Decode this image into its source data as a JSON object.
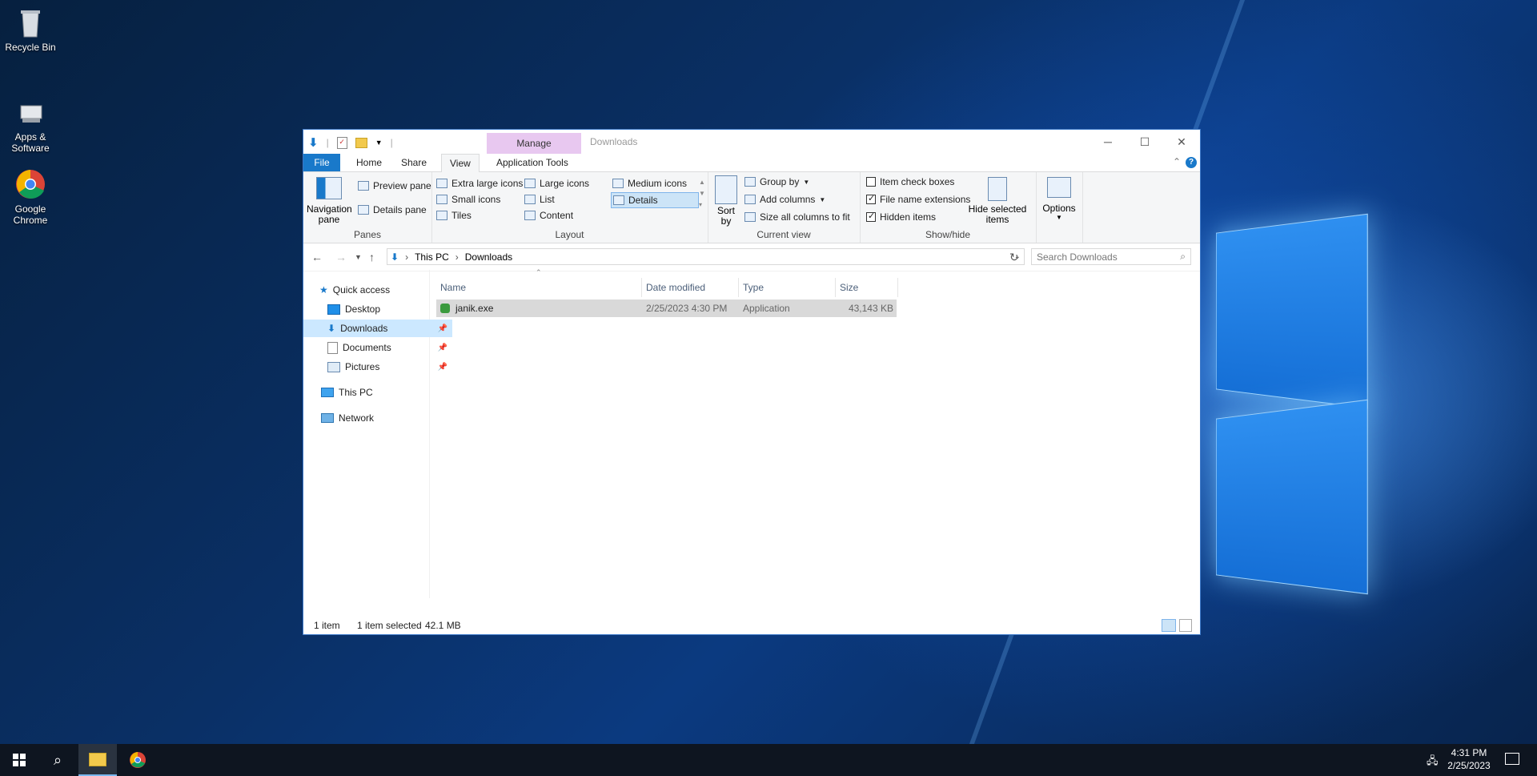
{
  "desktop": {
    "icons": [
      {
        "label": "Recycle Bin",
        "icon": "recycle-bin-icon"
      },
      {
        "label": "Apps & Software",
        "icon": "apps-software-icon"
      },
      {
        "label": "Google Chrome",
        "icon": "chrome-icon"
      }
    ]
  },
  "window": {
    "title": "Downloads",
    "context_tab": "Manage",
    "controls": {
      "minimize": "─",
      "maximize": "☐",
      "close": "✕"
    }
  },
  "tabs": [
    "File",
    "Home",
    "Share",
    "View",
    "Application Tools"
  ],
  "ribbon": {
    "panes": {
      "navigation_pane": "Navigation pane",
      "preview_pane": "Preview pane",
      "details_pane": "Details pane",
      "label": "Panes"
    },
    "layout": {
      "items": [
        "Extra large icons",
        "Large icons",
        "Medium icons",
        "Small icons",
        "List",
        "Details",
        "Tiles",
        "Content"
      ],
      "selected": "Details",
      "label": "Layout"
    },
    "current_view": {
      "sort_by": "Sort by",
      "group_by": "Group by",
      "add_columns": "Add columns",
      "size_all": "Size all columns to fit",
      "label": "Current view"
    },
    "show_hide": {
      "item_check_boxes": {
        "label": "Item check boxes",
        "checked": false
      },
      "file_name_extensions": {
        "label": "File name extensions",
        "checked": true
      },
      "hidden_items": {
        "label": "Hidden items",
        "checked": true
      },
      "hide_selected": "Hide selected items",
      "label": "Show/hide"
    },
    "options": "Options"
  },
  "address": {
    "crumbs": [
      "This PC",
      "Downloads"
    ],
    "search_placeholder": "Search Downloads"
  },
  "nav": {
    "quick_access": "Quick access",
    "items": [
      {
        "label": "Desktop",
        "pinned": true
      },
      {
        "label": "Downloads",
        "pinned": true,
        "selected": true
      },
      {
        "label": "Documents",
        "pinned": true
      },
      {
        "label": "Pictures",
        "pinned": true
      }
    ],
    "this_pc": "This PC",
    "network": "Network"
  },
  "columns": [
    "Name",
    "Date modified",
    "Type",
    "Size"
  ],
  "files": [
    {
      "name": "janik.exe",
      "date": "2/25/2023 4:30 PM",
      "type": "Application",
      "size": "43,143 KB"
    }
  ],
  "status": {
    "count": "1 item",
    "selected": "1 item selected",
    "size": "42.1 MB"
  },
  "taskbar": {
    "time": "4:31 PM",
    "date": "2/25/2023"
  },
  "colors": {
    "accent": "#1979ca",
    "manage_tab": "#e8c8f0",
    "selection": "#cce8ff"
  }
}
